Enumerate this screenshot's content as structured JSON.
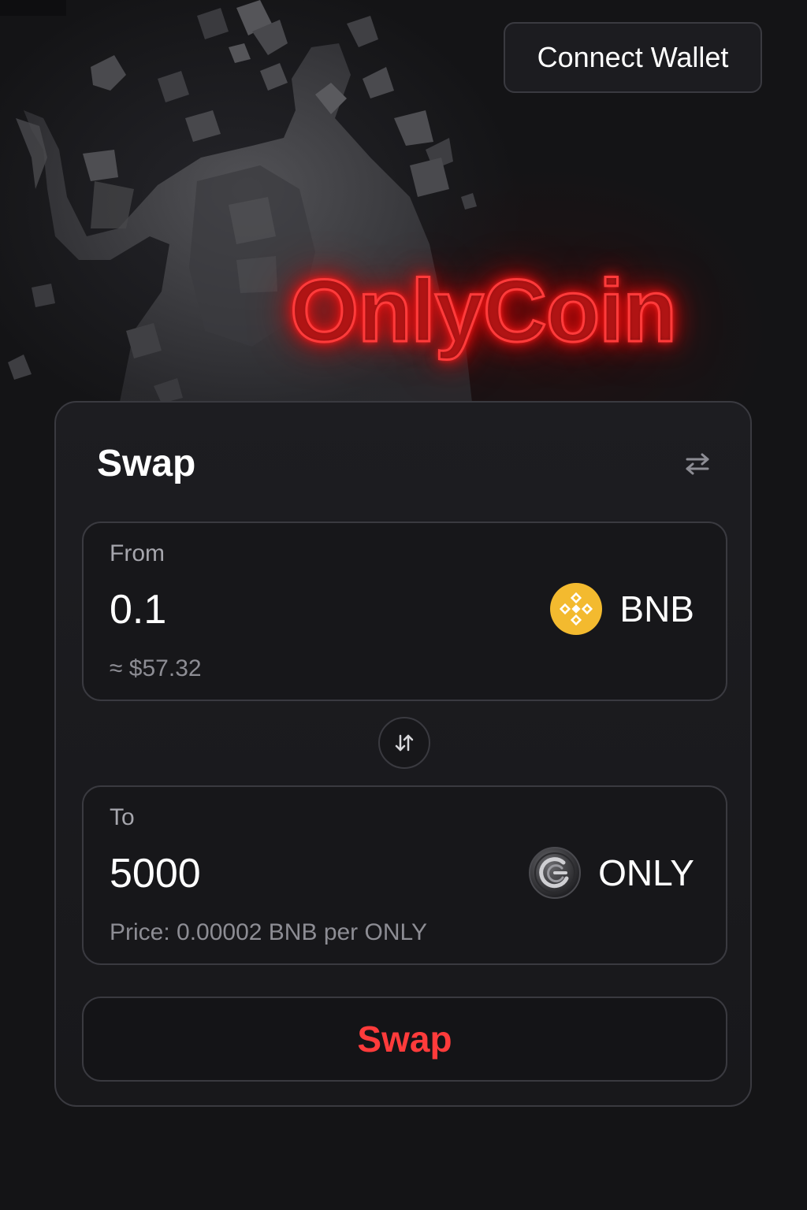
{
  "header": {
    "connect_wallet_label": "Connect Wallet"
  },
  "brand": {
    "title": "OnlyCoin",
    "glow_color": "#ff2b2b"
  },
  "swap": {
    "title": "Swap",
    "settings_icon": "sliders-swap-icon",
    "from": {
      "label": "From",
      "amount": "0.1",
      "usd_estimate": "≈ $57.32",
      "token": {
        "symbol": "BNB",
        "icon": "bnb-logo-icon",
        "icon_color": "#f3ba2f"
      }
    },
    "flip_icon": "swap-vertical-arrows-icon",
    "to": {
      "label": "To",
      "amount": "5000",
      "price_text": "Price: 0.00002 BNB per ONLY",
      "token": {
        "symbol": "ONLY",
        "icon": "only-coin-logo-icon"
      }
    },
    "submit_label": "Swap",
    "submit_color": "#ff3b3b"
  },
  "colors": {
    "background": "#141416",
    "card": "#1b1b1f",
    "border": "#3a3a40",
    "accent": "#ff3b3b"
  }
}
